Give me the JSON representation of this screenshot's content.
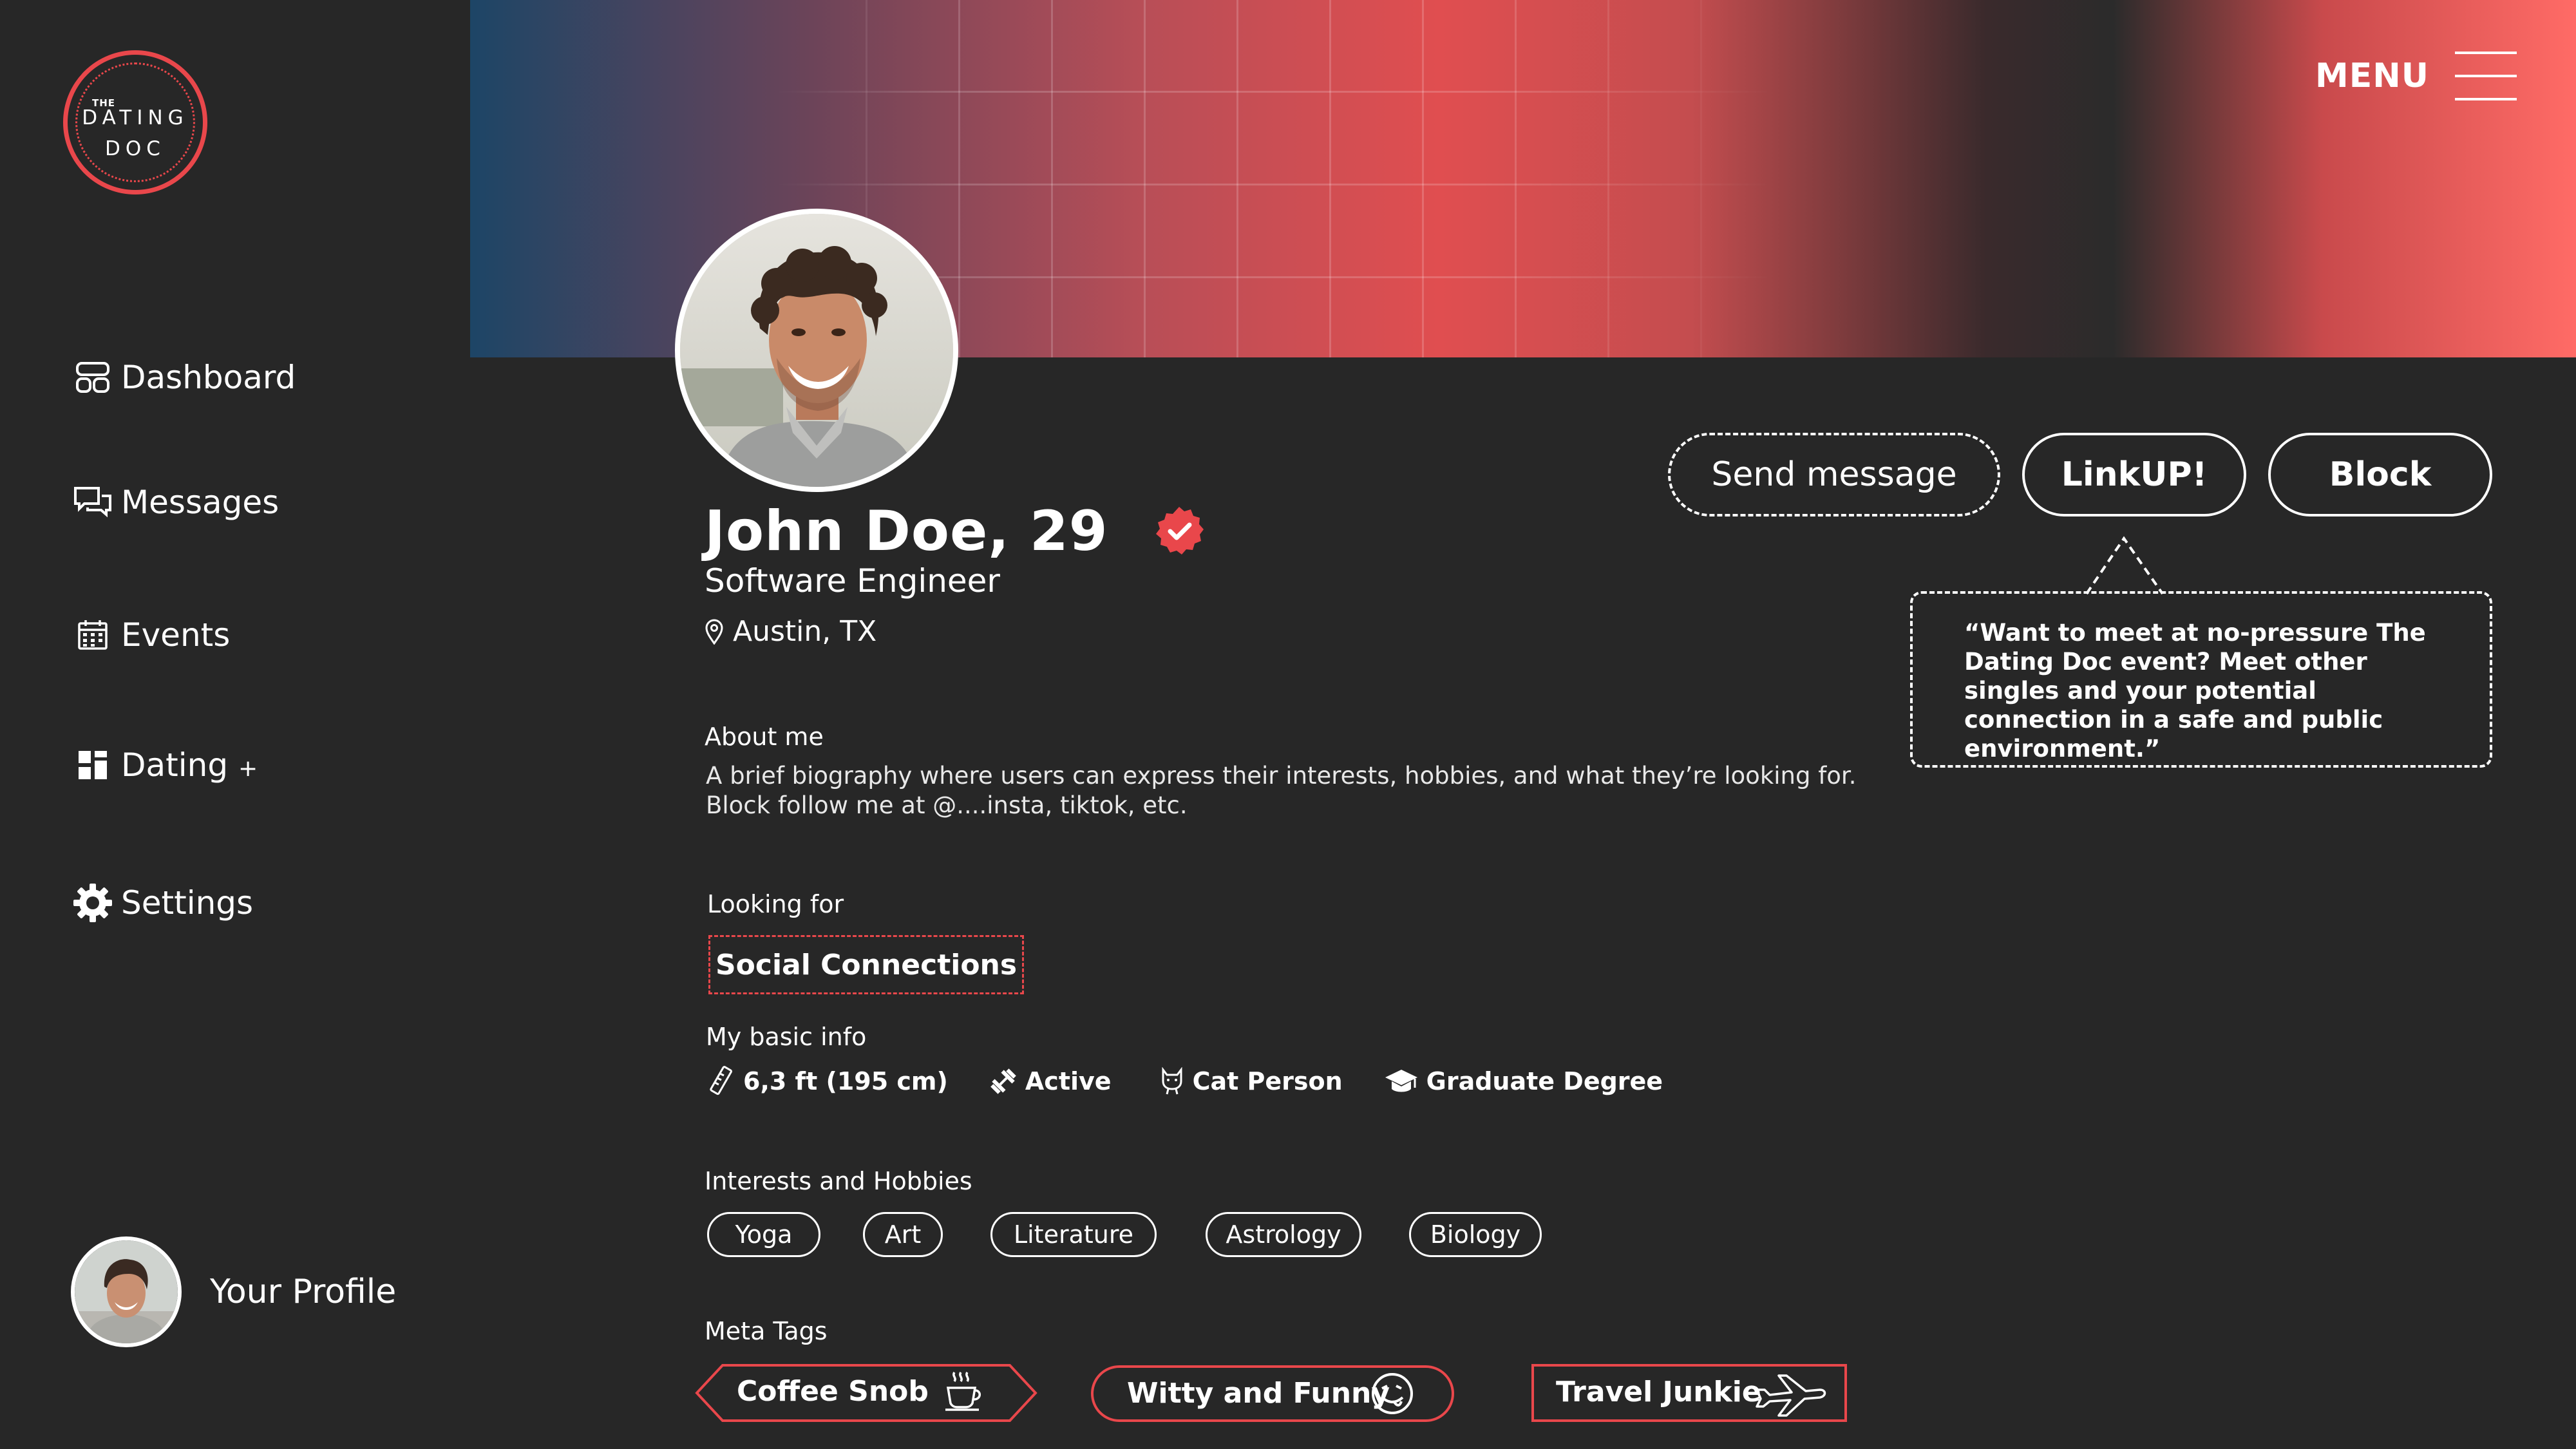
{
  "colors": {
    "accent": "#e9474b",
    "background": "#272727",
    "text": "#ffffff"
  },
  "logo": {
    "small": "THE",
    "line1": "DATING",
    "line2": "DOC"
  },
  "sidebar": {
    "items": [
      {
        "label": "Dashboard",
        "icon": "dashboard-icon"
      },
      {
        "label": "Messages",
        "icon": "messages-icon"
      },
      {
        "label": "Events",
        "icon": "calendar-icon"
      },
      {
        "label": "Dating",
        "suffix": "+",
        "icon": "grid-icon"
      },
      {
        "label": "Settings",
        "icon": "gear-icon"
      }
    ],
    "profile_label": "Your Profile"
  },
  "header": {
    "menu_label": "MENU"
  },
  "profile": {
    "name": "John Doe, 29",
    "title": "Software Engineer",
    "location": "Austin, TX",
    "about_label": "About me",
    "bio_line1": "A brief biography where users can express their interests, hobbies, and what they’re looking for.",
    "bio_line2": "Block follow me at @....insta, tiktok, etc.",
    "looking_label": "Looking for",
    "looking_value": "Social Connections",
    "basic_label": "My basic info",
    "basic": [
      {
        "label": "6,3 ft (195 cm)",
        "icon": "ruler-icon"
      },
      {
        "label": "Active",
        "icon": "dumbbell-icon"
      },
      {
        "label": "Cat Person",
        "icon": "cat-icon"
      },
      {
        "label": "Graduate Degree",
        "icon": "graduation-cap-icon"
      }
    ],
    "interests_label": "Interests and Hobbies",
    "interests": [
      "Yoga",
      "Art",
      "Literature",
      "Astrology",
      "Biology"
    ],
    "meta_label": "Meta Tags",
    "meta": [
      {
        "label": "Coffee Snob",
        "icon": "coffee-icon"
      },
      {
        "label": "Witty and Funny",
        "icon": "smiley-icon"
      },
      {
        "label": "Travel Junkie",
        "icon": "airplane-icon"
      }
    ]
  },
  "actions": {
    "send_message": "Send message",
    "linkup": "LinkUP!",
    "block": "Block",
    "tooltip": "“Want to meet at no-pressure The Dating Doc event? Meet other singles and your potential connection in a safe and public environment.”"
  }
}
